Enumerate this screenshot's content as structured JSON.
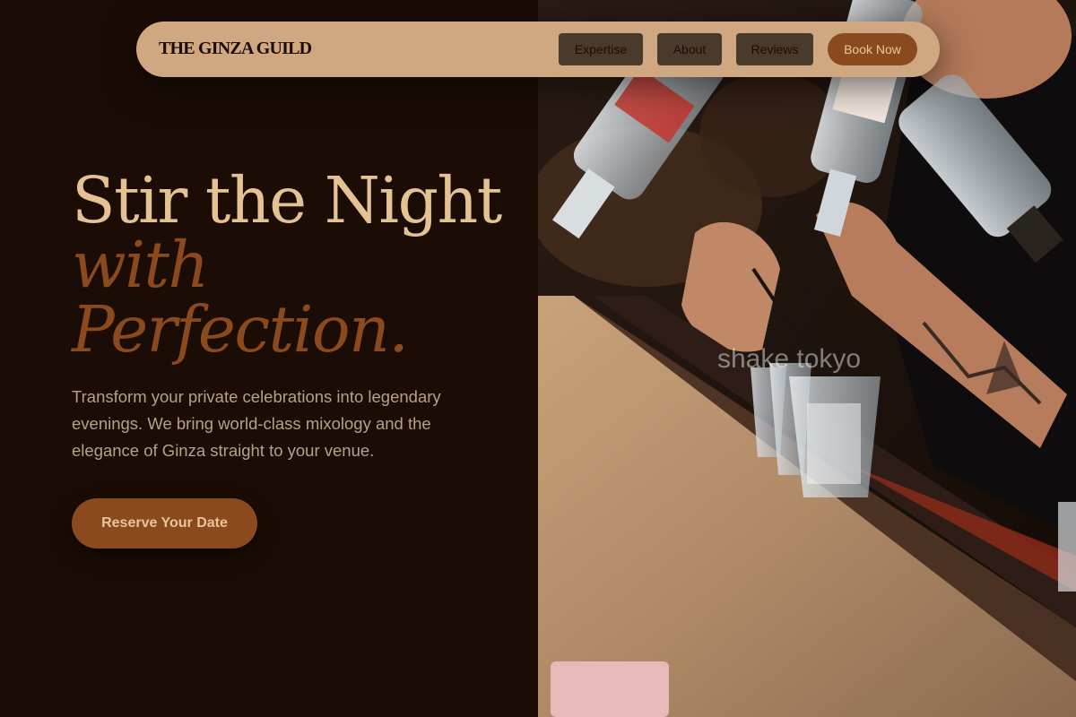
{
  "nav": {
    "brand": "THE GINZA GUILD",
    "links": [
      "Expertise",
      "About",
      "Reviews"
    ],
    "cta": "Book Now"
  },
  "hero": {
    "title_line1": "Stir the Night",
    "title_line2": "with",
    "title_line3": "Perfection.",
    "description": "Transform your private celebrations into legendary evenings. We bring world-class mixology and the elegance of Ginza straight to your venue.",
    "cta": "Reserve Your Date"
  },
  "image": {
    "subject": "bartender-pouring-bottles-photo",
    "watermark": "shake tokyo"
  },
  "colors": {
    "background": "#1b0d05",
    "nav_background": "#cfa780",
    "accent": "#8a4a1e",
    "title": "#e4c294",
    "body_text": "#b8a088"
  }
}
